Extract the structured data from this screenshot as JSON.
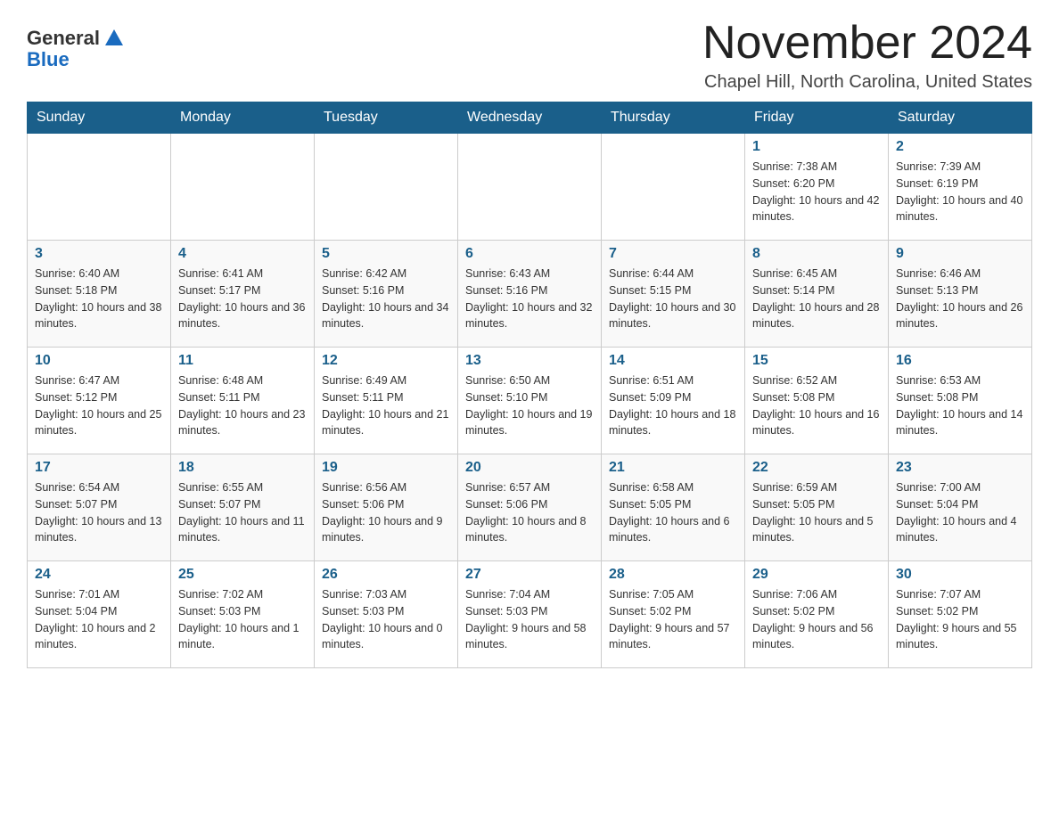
{
  "header": {
    "logo_general": "General",
    "logo_blue": "Blue",
    "month_title": "November 2024",
    "location": "Chapel Hill, North Carolina, United States"
  },
  "weekdays": [
    "Sunday",
    "Monday",
    "Tuesday",
    "Wednesday",
    "Thursday",
    "Friday",
    "Saturday"
  ],
  "weeks": [
    [
      {
        "day": "",
        "info": ""
      },
      {
        "day": "",
        "info": ""
      },
      {
        "day": "",
        "info": ""
      },
      {
        "day": "",
        "info": ""
      },
      {
        "day": "",
        "info": ""
      },
      {
        "day": "1",
        "info": "Sunrise: 7:38 AM\nSunset: 6:20 PM\nDaylight: 10 hours and 42 minutes."
      },
      {
        "day": "2",
        "info": "Sunrise: 7:39 AM\nSunset: 6:19 PM\nDaylight: 10 hours and 40 minutes."
      }
    ],
    [
      {
        "day": "3",
        "info": "Sunrise: 6:40 AM\nSunset: 5:18 PM\nDaylight: 10 hours and 38 minutes."
      },
      {
        "day": "4",
        "info": "Sunrise: 6:41 AM\nSunset: 5:17 PM\nDaylight: 10 hours and 36 minutes."
      },
      {
        "day": "5",
        "info": "Sunrise: 6:42 AM\nSunset: 5:16 PM\nDaylight: 10 hours and 34 minutes."
      },
      {
        "day": "6",
        "info": "Sunrise: 6:43 AM\nSunset: 5:16 PM\nDaylight: 10 hours and 32 minutes."
      },
      {
        "day": "7",
        "info": "Sunrise: 6:44 AM\nSunset: 5:15 PM\nDaylight: 10 hours and 30 minutes."
      },
      {
        "day": "8",
        "info": "Sunrise: 6:45 AM\nSunset: 5:14 PM\nDaylight: 10 hours and 28 minutes."
      },
      {
        "day": "9",
        "info": "Sunrise: 6:46 AM\nSunset: 5:13 PM\nDaylight: 10 hours and 26 minutes."
      }
    ],
    [
      {
        "day": "10",
        "info": "Sunrise: 6:47 AM\nSunset: 5:12 PM\nDaylight: 10 hours and 25 minutes."
      },
      {
        "day": "11",
        "info": "Sunrise: 6:48 AM\nSunset: 5:11 PM\nDaylight: 10 hours and 23 minutes."
      },
      {
        "day": "12",
        "info": "Sunrise: 6:49 AM\nSunset: 5:11 PM\nDaylight: 10 hours and 21 minutes."
      },
      {
        "day": "13",
        "info": "Sunrise: 6:50 AM\nSunset: 5:10 PM\nDaylight: 10 hours and 19 minutes."
      },
      {
        "day": "14",
        "info": "Sunrise: 6:51 AM\nSunset: 5:09 PM\nDaylight: 10 hours and 18 minutes."
      },
      {
        "day": "15",
        "info": "Sunrise: 6:52 AM\nSunset: 5:08 PM\nDaylight: 10 hours and 16 minutes."
      },
      {
        "day": "16",
        "info": "Sunrise: 6:53 AM\nSunset: 5:08 PM\nDaylight: 10 hours and 14 minutes."
      }
    ],
    [
      {
        "day": "17",
        "info": "Sunrise: 6:54 AM\nSunset: 5:07 PM\nDaylight: 10 hours and 13 minutes."
      },
      {
        "day": "18",
        "info": "Sunrise: 6:55 AM\nSunset: 5:07 PM\nDaylight: 10 hours and 11 minutes."
      },
      {
        "day": "19",
        "info": "Sunrise: 6:56 AM\nSunset: 5:06 PM\nDaylight: 10 hours and 9 minutes."
      },
      {
        "day": "20",
        "info": "Sunrise: 6:57 AM\nSunset: 5:06 PM\nDaylight: 10 hours and 8 minutes."
      },
      {
        "day": "21",
        "info": "Sunrise: 6:58 AM\nSunset: 5:05 PM\nDaylight: 10 hours and 6 minutes."
      },
      {
        "day": "22",
        "info": "Sunrise: 6:59 AM\nSunset: 5:05 PM\nDaylight: 10 hours and 5 minutes."
      },
      {
        "day": "23",
        "info": "Sunrise: 7:00 AM\nSunset: 5:04 PM\nDaylight: 10 hours and 4 minutes."
      }
    ],
    [
      {
        "day": "24",
        "info": "Sunrise: 7:01 AM\nSunset: 5:04 PM\nDaylight: 10 hours and 2 minutes."
      },
      {
        "day": "25",
        "info": "Sunrise: 7:02 AM\nSunset: 5:03 PM\nDaylight: 10 hours and 1 minute."
      },
      {
        "day": "26",
        "info": "Sunrise: 7:03 AM\nSunset: 5:03 PM\nDaylight: 10 hours and 0 minutes."
      },
      {
        "day": "27",
        "info": "Sunrise: 7:04 AM\nSunset: 5:03 PM\nDaylight: 9 hours and 58 minutes."
      },
      {
        "day": "28",
        "info": "Sunrise: 7:05 AM\nSunset: 5:02 PM\nDaylight: 9 hours and 57 minutes."
      },
      {
        "day": "29",
        "info": "Sunrise: 7:06 AM\nSunset: 5:02 PM\nDaylight: 9 hours and 56 minutes."
      },
      {
        "day": "30",
        "info": "Sunrise: 7:07 AM\nSunset: 5:02 PM\nDaylight: 9 hours and 55 minutes."
      }
    ]
  ]
}
